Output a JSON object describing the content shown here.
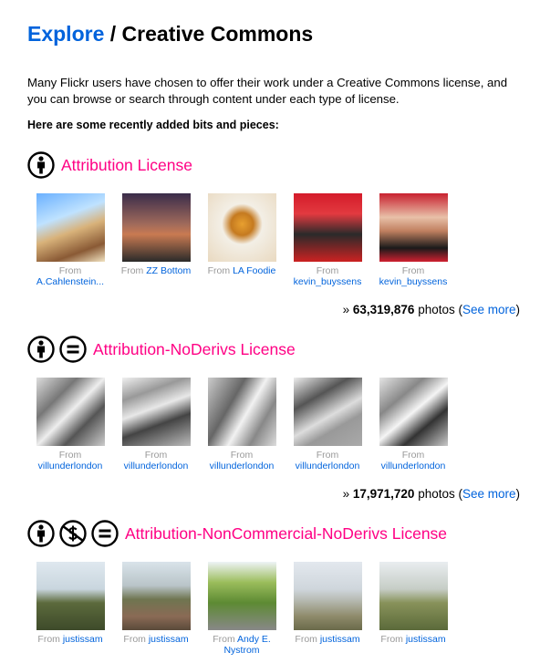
{
  "header": {
    "explore": "Explore",
    "separator": "/",
    "title": "Creative Commons"
  },
  "intro": "Many Flickr users have chosen to offer their work under a Creative Commons license, and you can browse or search through content under each type of license.",
  "subhead": "Here are some recently added bits and pieces:",
  "colors": {
    "link": "#0063dc",
    "license_title": "#ff0084"
  },
  "licenses": [
    {
      "title": "Attribution License",
      "icons": [
        "attribution-icon"
      ],
      "photos": [
        {
          "from": "From",
          "author": "A.Cahlenstein..."
        },
        {
          "from": "From",
          "author": "ZZ Bottom"
        },
        {
          "from": "From",
          "author": "LA Foodie"
        },
        {
          "from": "From",
          "author": "kevin_buyssens"
        },
        {
          "from": "From",
          "author": "kevin_buyssens"
        }
      ],
      "count_prefix": "»",
      "count": "63,319,876",
      "count_suffix": "photos (",
      "see_more": "See more",
      "close": ")"
    },
    {
      "title": "Attribution-NoDerivs License",
      "icons": [
        "attribution-icon",
        "no-derivs-icon"
      ],
      "photos": [
        {
          "from": "From",
          "author": "villunderlondon"
        },
        {
          "from": "From",
          "author": "villunderlondon"
        },
        {
          "from": "From",
          "author": "villunderlondon"
        },
        {
          "from": "From",
          "author": "villunderlondon"
        },
        {
          "from": "From",
          "author": "villunderlondon"
        }
      ],
      "count_prefix": "»",
      "count": "17,971,720",
      "count_suffix": "photos (",
      "see_more": "See more",
      "close": ")"
    },
    {
      "title": "Attribution-NonCommercial-NoDerivs License",
      "icons": [
        "attribution-icon",
        "non-commercial-icon",
        "no-derivs-icon"
      ],
      "photos": [
        {
          "from": "From",
          "author": "justissam"
        },
        {
          "from": "From",
          "author": "justissam"
        },
        {
          "from": "From",
          "author": "Andy E. Nystrom"
        },
        {
          "from": "From",
          "author": "justissam"
        },
        {
          "from": "From",
          "author": "justissam"
        }
      ]
    }
  ]
}
